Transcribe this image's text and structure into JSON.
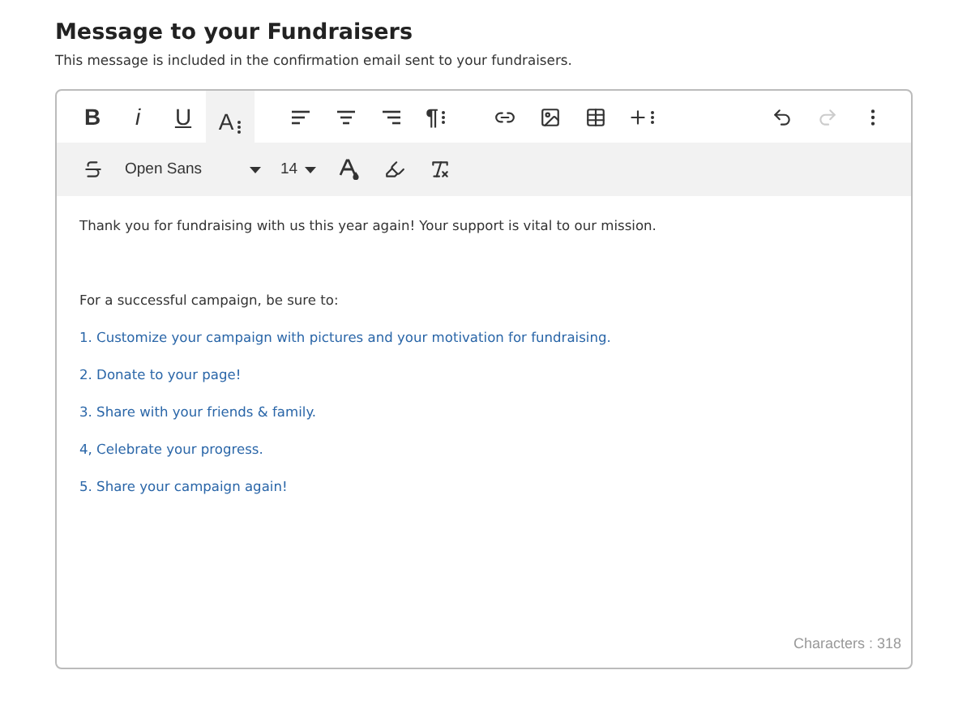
{
  "heading": "Message to your Fundraisers",
  "description": "This message is included in the confirmation email sent to your fundraisers.",
  "toolbar_row_1": [
    {
      "kind": "bold",
      "label": "B",
      "selected": false
    },
    {
      "kind": "italic",
      "label": "i",
      "selected": false
    },
    {
      "kind": "underline",
      "label": "U",
      "selected": false
    },
    {
      "kind": "text-style",
      "label": "A",
      "selected": true
    },
    {
      "kind": "gap"
    },
    {
      "kind": "align-left",
      "selected": false
    },
    {
      "kind": "align-center",
      "selected": false
    },
    {
      "kind": "align-right",
      "selected": false
    },
    {
      "kind": "paragraph",
      "label": "¶",
      "selected": false
    },
    {
      "kind": "gap"
    },
    {
      "kind": "link",
      "selected": false
    },
    {
      "kind": "image",
      "selected": false
    },
    {
      "kind": "table",
      "selected": false
    },
    {
      "kind": "insert",
      "selected": false
    },
    {
      "kind": "spacer"
    },
    {
      "kind": "undo",
      "selected": false,
      "disabled": false
    },
    {
      "kind": "redo",
      "selected": false,
      "disabled": true
    },
    {
      "kind": "more",
      "selected": false,
      "disabled": false
    }
  ],
  "toolbar_row_2": [
    {
      "kind": "strikethrough",
      "selected": false
    },
    {
      "kind": "font",
      "value": "Open Sans"
    },
    {
      "kind": "size",
      "value": "14"
    },
    {
      "kind": "text-color",
      "selected": false
    },
    {
      "kind": "highlight",
      "selected": false
    },
    {
      "kind": "clear-format",
      "selected": false
    }
  ],
  "content": [
    {
      "kind": "plain",
      "text": "Thank you for fundraising with us this year again! Your support is vital to our mission."
    },
    {
      "kind": "blank"
    },
    {
      "kind": "plain",
      "text": "For a successful campaign, be sure to:"
    },
    {
      "kind": "list",
      "text": "1. Customize your campaign with pictures and your motivation for fundraising."
    },
    {
      "kind": "list",
      "text": "2. Donate to your page!"
    },
    {
      "kind": "list",
      "text": "3. Share with your friends & family."
    },
    {
      "kind": "list",
      "text": "4, Celebrate your progress."
    },
    {
      "kind": "list",
      "text": "5. Share your campaign again!"
    }
  ],
  "character_count": "Characters : 318"
}
